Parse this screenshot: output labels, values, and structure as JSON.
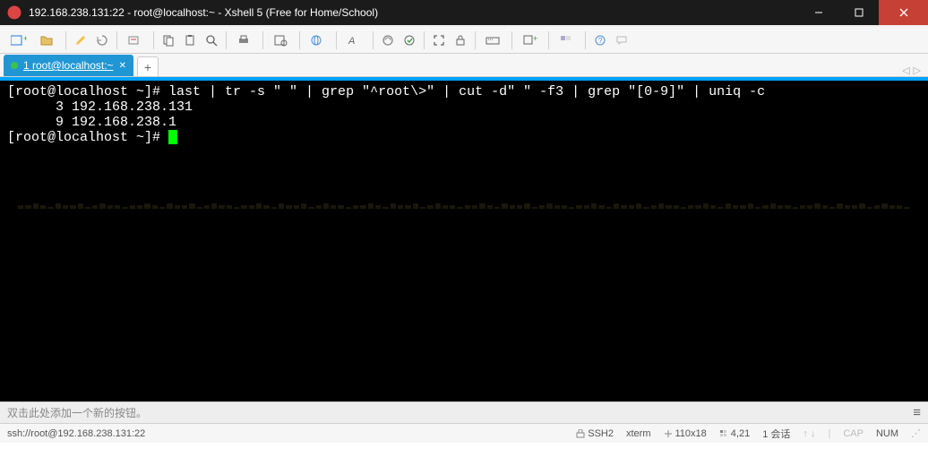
{
  "titlebar": {
    "text": "192.168.238.131:22 - root@localhost:~ - Xshell 5 (Free for Home/School)"
  },
  "tab": {
    "label": "1 root@localhost:~"
  },
  "terminal": {
    "line1_prompt": "[root@localhost ~]# ",
    "line1_cmd": "last | tr -s \" \" | grep \"^root\\>\" | cut -d\" \" -f3 | grep \"[0-9]\" | uniq -c",
    "line2": "      3 192.168.238.131",
    "line3": "      9 192.168.238.1",
    "line4_prompt": "[root@localhost ~]# "
  },
  "bottom_hint": "双击此处添加一个新的按钮。",
  "statusbar": {
    "left": "ssh://root@192.168.238.131:22",
    "ssh": "SSH2",
    "term": "xterm",
    "size": "110x18",
    "pos": "4,21",
    "session": "1 会话",
    "cap": "CAP",
    "num": "NUM"
  }
}
